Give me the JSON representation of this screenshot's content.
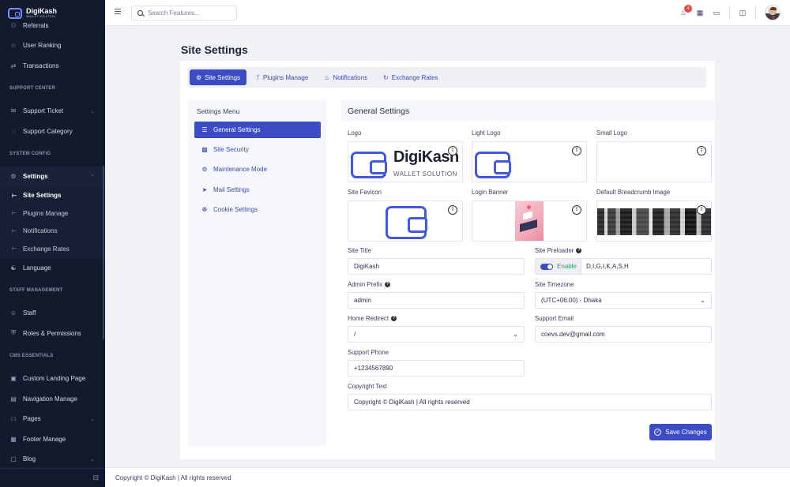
{
  "brand": {
    "name": "DigiKash",
    "sub": "WALLET SOLUTION"
  },
  "sidebar": {
    "top_items": [
      {
        "label": "Referrals",
        "icon": "users-icon"
      },
      {
        "label": "User Ranking",
        "icon": "ranking-icon"
      },
      {
        "label": "Transactions",
        "icon": "transactions-icon"
      }
    ],
    "support_center": {
      "title": "SUPPORT CENTER",
      "items": [
        {
          "label": "Support Ticket",
          "icon": "ticket-icon"
        },
        {
          "label": "Support Category",
          "icon": "category-icon"
        }
      ]
    },
    "system_config": {
      "title": "SYSTEM CONFIG",
      "settings_label": "Settings",
      "sub_items": [
        {
          "label": "Site Settings",
          "active": true
        },
        {
          "label": "Plugins Manage"
        },
        {
          "label": "Notifications"
        },
        {
          "label": "Exchange Rates"
        }
      ],
      "language_label": "Language"
    },
    "staff_management": {
      "title": "STAFF MANAGEMENT",
      "items": [
        {
          "label": "Staff"
        },
        {
          "label": "Roles & Permissions"
        }
      ]
    },
    "cms": {
      "title": "CMS ESSENTIALS",
      "items": [
        {
          "label": "Custom Landing Page"
        },
        {
          "label": "Navigation Manage"
        },
        {
          "label": "Pages"
        },
        {
          "label": "Footer Manage"
        },
        {
          "label": "Blog"
        }
      ]
    }
  },
  "topbar": {
    "search_placeholder": "Search Features...",
    "notification_count": "4"
  },
  "page": {
    "title": "Site Settings"
  },
  "tabs": [
    {
      "label": "Site Settings",
      "active": true
    },
    {
      "label": "Plugins Manage"
    },
    {
      "label": "Notifications"
    },
    {
      "label": "Exchange Rates"
    }
  ],
  "settings_menu": {
    "title": "Settings Menu",
    "items": [
      {
        "label": "General Settings",
        "active": true
      },
      {
        "label": "Site Security"
      },
      {
        "label": "Maintenance Mode"
      },
      {
        "label": "Mail Settings"
      },
      {
        "label": "Cookie Settings"
      }
    ]
  },
  "general": {
    "title": "General Settings",
    "images": {
      "logo": "Logo",
      "light_logo": "Light Logo",
      "small_logo": "Small Logo",
      "site_favicon": "Site Favicon",
      "login_banner": "Login Banner",
      "breadcrumb": "Default Breadcrumb Image"
    },
    "logo_text": {
      "name": "DigiKash",
      "sub": "WALLET SOLUTION"
    },
    "fields": {
      "site_title": {
        "label": "Site Title",
        "value": "DigiKash"
      },
      "site_preloader": {
        "label": "Site Preloader",
        "toggle": "Enable",
        "value": "D,I,G,I,K,A,S,H"
      },
      "admin_prefix": {
        "label": "Admin Prefix",
        "value": "admin"
      },
      "site_timezone": {
        "label": "Site Timezone",
        "value": "(UTC+06:00) - Dhaka"
      },
      "home_redirect": {
        "label": "Home Redirect",
        "value": "/"
      },
      "support_email": {
        "label": "Support Email",
        "value": "coevs.dev@gmail.com"
      },
      "support_phone": {
        "label": "Support Phone",
        "value": "+1234567890"
      },
      "copyright": {
        "label": "Copyright Text",
        "value": "Copyright © DigiKash  | All rights reserved"
      }
    },
    "save_label": "Save Changes"
  },
  "footer": {
    "text": "Copyright © DigiKash | All rights reserved"
  },
  "colors": {
    "primary": "#3b4cc4",
    "sidebar": "#131a2e",
    "success": "#2e9a5f",
    "badge": "#e5484d"
  }
}
